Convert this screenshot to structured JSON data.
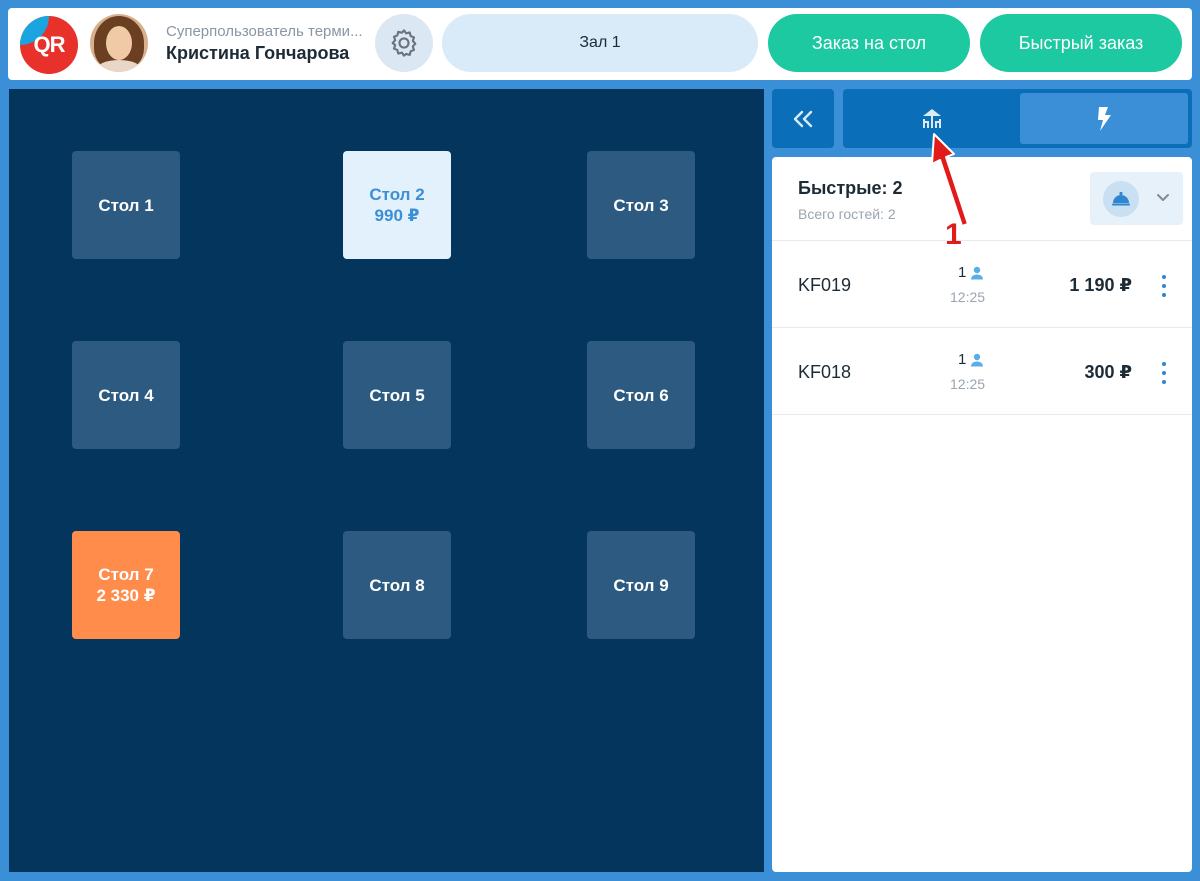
{
  "header": {
    "logo_text": "QR",
    "user_role": "Суперпользователь терми...",
    "user_name": "Кристина Гончарова",
    "settings_icon": "gear-icon",
    "hall_label": "Зал 1",
    "table_order_label": "Заказ на стол",
    "quick_order_label": "Быстрый заказ"
  },
  "colors": {
    "header_bg": "#ffffff",
    "page_bg": "#3a8fd6",
    "hall_bg": "#04365d",
    "table_free": "#2c5a80",
    "table_light": "#e3f1fc",
    "table_busy": "#ff8c4b",
    "accent_green": "#1cc9a0",
    "accent_blue": "#0a6fb8",
    "annotation": "#e21a1a"
  },
  "tables": [
    {
      "name": "Стол 1",
      "amount": "",
      "state": "free"
    },
    {
      "name": "Стол 2",
      "amount": "990 ₽",
      "state": "light"
    },
    {
      "name": "Стол 3",
      "amount": "",
      "state": "free"
    },
    {
      "name": "Стол 4",
      "amount": "",
      "state": "free"
    },
    {
      "name": "Стол 5",
      "amount": "",
      "state": "free"
    },
    {
      "name": "Стол 6",
      "amount": "",
      "state": "free"
    },
    {
      "name": "Стол 7",
      "amount": "2 330 ₽",
      "state": "busy"
    },
    {
      "name": "Стол 8",
      "amount": "",
      "state": "free"
    },
    {
      "name": "Стол 9",
      "amount": "",
      "state": "free"
    }
  ],
  "side": {
    "collapse_icon": "double-chevron-left-icon",
    "mode_tabs": [
      {
        "icon": "table-icon",
        "active": false
      },
      {
        "icon": "lightning-icon",
        "active": true
      }
    ],
    "title": "Быстрые: 2",
    "subtitle": "Всего гостей: 2",
    "filter_icon": "cloche-icon",
    "orders": [
      {
        "code": "KF019",
        "guests": "1",
        "time": "12:25",
        "price": "1 190 ₽"
      },
      {
        "code": "KF018",
        "guests": "1",
        "time": "12:25",
        "price": "300 ₽"
      }
    ]
  },
  "annotation": {
    "number": "1"
  }
}
